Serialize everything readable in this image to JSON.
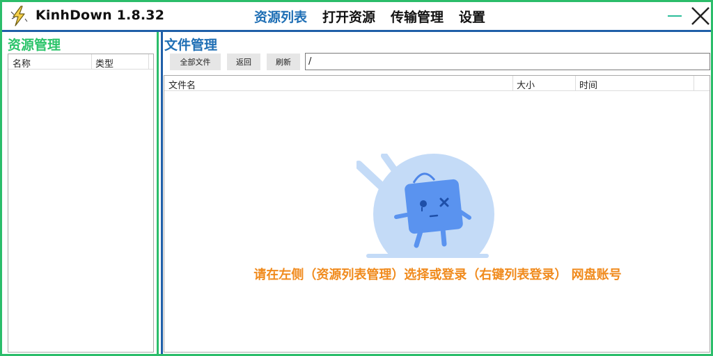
{
  "app": {
    "title": "KinhDown 1.8.32"
  },
  "nav": {
    "items": [
      {
        "label": "资源列表",
        "active": true
      },
      {
        "label": "打开资源",
        "active": false
      },
      {
        "label": "传输管理",
        "active": false
      },
      {
        "label": "设置",
        "active": false
      }
    ]
  },
  "left": {
    "title": "资源管理",
    "columns": [
      "名称",
      "类型"
    ]
  },
  "right": {
    "title": "文件管理",
    "toolbar": {
      "all_files": "全部文件",
      "back": "返回",
      "refresh": "刷新",
      "path": "/"
    },
    "columns": [
      "文件名",
      "大小",
      "时间"
    ],
    "empty_message": "请在左侧（资源列表管理）选择或登录（右键列表登录） 网盘账号"
  },
  "colors": {
    "accent_blue": "#1f6fb5",
    "accent_green": "#2bc46a",
    "message_orange": "#f08a1c"
  }
}
